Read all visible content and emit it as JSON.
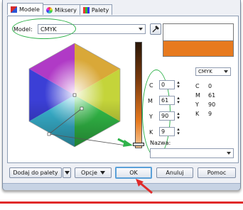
{
  "tabs": [
    {
      "label": "Modele",
      "icon": "palette-model-icon",
      "active": true
    },
    {
      "label": "Miksery",
      "icon": "mixer-ring-icon",
      "active": false
    },
    {
      "label": "Palety",
      "icon": "palette-grid-icon",
      "active": false
    }
  ],
  "model": {
    "label": "Model:",
    "value": "CMYK"
  },
  "swatches": {
    "old": "#ffffff",
    "new": "#e77a1f"
  },
  "picker_mode": "CMYK",
  "cmyk_inputs": [
    {
      "label": "C",
      "value": "0"
    },
    {
      "label": "M",
      "value": "61"
    },
    {
      "label": "Y",
      "value": "90"
    },
    {
      "label": "K",
      "value": "9"
    }
  ],
  "cmyk_readout": [
    {
      "label": "C",
      "value": "0"
    },
    {
      "label": "M",
      "value": "61"
    },
    {
      "label": "Y",
      "value": "90"
    },
    {
      "label": "K",
      "value": "9"
    }
  ],
  "name_field": {
    "label": "Nazwa:",
    "value": ""
  },
  "buttons": {
    "add_to_palette": "Dodaj do palety",
    "options": "Opcje",
    "ok": "OK",
    "cancel": "Anuluj",
    "help": "Pomoc"
  },
  "annotation_colors": {
    "highlight": "#2fb24a",
    "pointer": "#e02a2a"
  }
}
